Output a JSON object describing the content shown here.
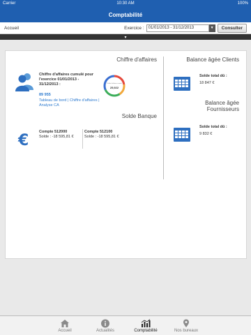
{
  "status": {
    "carrier": "Carrier",
    "time": "10:30 AM",
    "battery": "100%"
  },
  "nav": {
    "title": "Comptabilité"
  },
  "subbar": {
    "back": "Accueil",
    "exercice_label": "Exercice :",
    "exercice_value": "01/01/2013 - 31/12/2013",
    "consult": "Consulter"
  },
  "ca": {
    "title": "Chiffre d'affaires",
    "desc": "Chiffre d'affaires cumulé pour l'exercice 01/01/2013 - 31/12/2013 :",
    "value": "89 955",
    "links": "Tableau de bord | Chiffre d'affaires | Analyse CA",
    "donut_top": "Chiffre d'affaires cumulé",
    "donut_value": "25,922"
  },
  "banque": {
    "title": "Solde Banque",
    "accounts": [
      {
        "name": "Compte 512000",
        "solde": "Solde : -18 595,81 €"
      },
      {
        "name": "Compte 512100",
        "solde": "Solde : -18 595,81 €"
      }
    ]
  },
  "clients": {
    "title": "Balance âgée Clients",
    "label": "Solde total dû :",
    "value": "18 847 €"
  },
  "fournisseurs": {
    "title": "Balance âgée Fournisseurs",
    "label": "Solde total dû :",
    "value": "9 832 €"
  },
  "tabs": [
    {
      "label": "Accueil"
    },
    {
      "label": "Actualités"
    },
    {
      "label": "Comptabilité"
    },
    {
      "label": "Nos bureaux"
    }
  ],
  "colors": {
    "primary": "#1f5fb0",
    "link": "#2e7bcf"
  }
}
